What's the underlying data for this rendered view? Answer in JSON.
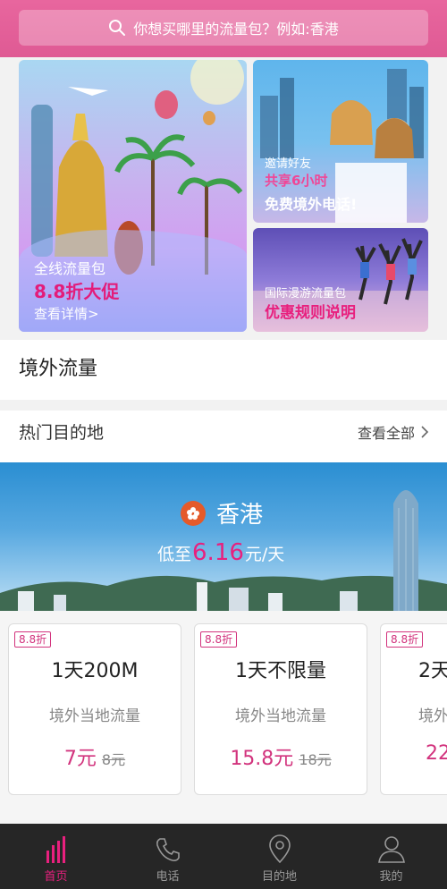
{
  "search": {
    "placeholder": "你想买哪里的流量包？例如:香港"
  },
  "banners": {
    "main": {
      "line1": "全线流量包",
      "line2": "8.8折大促",
      "line3": "查看详情>"
    },
    "invite": {
      "line1": "邀请好友",
      "line2_pre": "共享",
      "line2_hi": "6小时",
      "line3": "免费境外电话!"
    },
    "roaming": {
      "line1": "国际漫游流量包",
      "line2": "优惠规则说明"
    }
  },
  "section": {
    "title": "境外流量"
  },
  "hot": {
    "label": "热门目的地",
    "more": "查看全部"
  },
  "destination": {
    "name": "香港",
    "price_prefix": "低至",
    "price_value": "6.16",
    "price_suffix": "元/天"
  },
  "cards": [
    {
      "badge": "8.8折",
      "name": "1天200M",
      "desc": "境外当地流量",
      "price": "7元",
      "old_price": "8元"
    },
    {
      "badge": "8.8折",
      "name": "1天不限量",
      "desc": "境外当地流量",
      "price": "15.8元",
      "old_price": "18元"
    },
    {
      "badge": "8.8折",
      "name": "2天",
      "desc": "境外",
      "price": "22",
      "old_price": ""
    }
  ],
  "tabs": [
    {
      "label": "首页",
      "icon": "bars-icon",
      "active": true
    },
    {
      "label": "电话",
      "icon": "phone-icon",
      "active": false
    },
    {
      "label": "目的地",
      "icon": "location-pin-icon",
      "active": false
    },
    {
      "label": "我的",
      "icon": "person-icon",
      "active": false
    }
  ],
  "colors": {
    "brand": "#e8669e",
    "accent": "#e8207e",
    "tabbar": "#262626"
  }
}
